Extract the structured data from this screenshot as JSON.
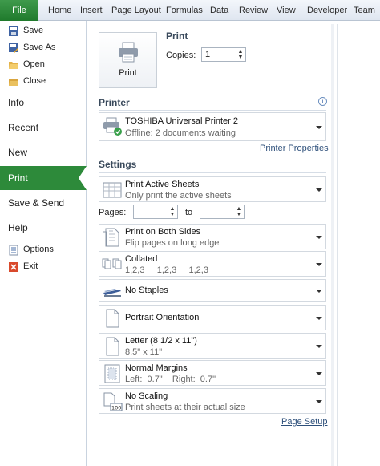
{
  "ribbon": {
    "file": "File",
    "tabs": [
      "Home",
      "Insert",
      "Page Layout",
      "Formulas",
      "Data",
      "Review",
      "View",
      "Developer",
      "Team"
    ]
  },
  "nav": {
    "commands_top": [
      {
        "label": "Save",
        "icon": "save-icon"
      },
      {
        "label": "Save As",
        "icon": "save-as-icon"
      },
      {
        "label": "Open",
        "icon": "open-folder-icon"
      },
      {
        "label": "Close",
        "icon": "close-file-icon"
      }
    ],
    "items": [
      "Info",
      "Recent",
      "New",
      "Print",
      "Save & Send",
      "Help"
    ],
    "selected": "Print",
    "commands_bottom": [
      {
        "label": "Options",
        "icon": "options-icon"
      },
      {
        "label": "Exit",
        "icon": "exit-icon"
      }
    ]
  },
  "print": {
    "title": "Print",
    "button_label": "Print",
    "copies_label": "Copies:",
    "copies_value": "1"
  },
  "printer": {
    "title": "Printer",
    "name": "TOSHIBA Universal Printer 2",
    "status": "Offline: 2 documents waiting",
    "properties_link": "Printer Properties"
  },
  "settings": {
    "title": "Settings",
    "pages_label": "Pages:",
    "pages_to": "to",
    "page_setup_link": "Page Setup",
    "options": [
      {
        "title": "Print Active Sheets",
        "sub": "Only print the active sheets",
        "icon": "sheets-icon"
      },
      {
        "title": "Print on Both Sides",
        "sub": "Flip pages on long edge",
        "icon": "duplex-icon"
      },
      {
        "title": "Collated",
        "sub": "1,2,3     1,2,3     1,2,3",
        "icon": "collated-icon"
      },
      {
        "title": "No Staples",
        "sub": "",
        "icon": "stapler-icon"
      },
      {
        "title": "Portrait Orientation",
        "sub": "",
        "icon": "portrait-icon"
      },
      {
        "title": "Letter (8 1/2 x 11\")",
        "sub": "8.5\" x 11\"",
        "icon": "paper-size-icon"
      },
      {
        "title": "Normal Margins",
        "sub": "Left:  0.7\"    Right:  0.7\"",
        "icon": "margins-icon"
      },
      {
        "title": "No Scaling",
        "sub": "Print sheets at their actual size",
        "icon": "scaling-icon"
      }
    ]
  },
  "colors": {
    "accent_green": "#2d8a3a",
    "link_blue": "#2d4f7a"
  }
}
